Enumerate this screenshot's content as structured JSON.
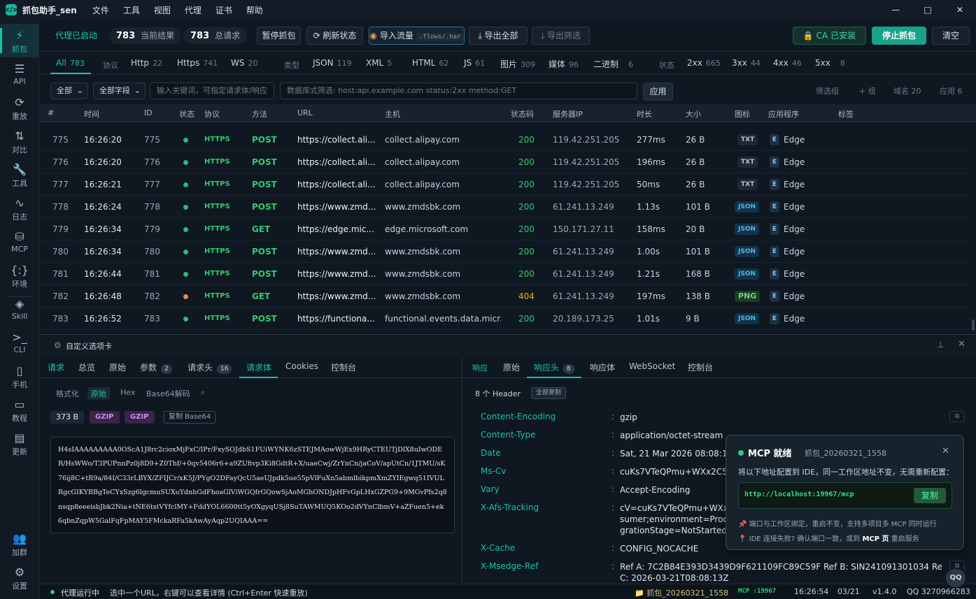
{
  "app": {
    "logo": "</>",
    "title": "抓包助手_sen",
    "menu": [
      "文件",
      "工具",
      "视图",
      "代理",
      "证书",
      "帮助"
    ],
    "window_buttons": [
      "—",
      "□",
      "✕"
    ]
  },
  "sidebar": [
    {
      "icon": "⚡",
      "label": "抓包",
      "active": true
    },
    {
      "icon": "☰",
      "label": "API"
    },
    {
      "icon": "⟳",
      "label": "重放"
    },
    {
      "icon": "⇅",
      "label": "对比"
    },
    {
      "icon": "🔧",
      "label": "工具"
    },
    {
      "icon": "∿",
      "label": "日志"
    },
    {
      "icon": "⛁",
      "label": "MCP"
    },
    {
      "icon": "{:}",
      "label": "环境"
    },
    {
      "icon": "◈",
      "label": "Skill"
    },
    {
      "icon": ">_",
      "label": "CLI"
    },
    {
      "icon": "▯",
      "label": "手机"
    },
    {
      "icon": "▭",
      "label": "教程"
    },
    {
      "icon": "▤",
      "label": "更新"
    },
    {
      "icon": "👥",
      "label": "加群"
    },
    {
      "icon": "⚙",
      "label": "设置"
    }
  ],
  "toolbar": {
    "proxy_status": "代理已启动",
    "current_count": "783",
    "current_label": "当前结果",
    "total_count": "783",
    "total_label": "总请求",
    "pause": "暂停抓包",
    "refresh": "⟳ 刷新状态",
    "import": "导入流量",
    "import_hint": ".flows/.har",
    "export_all": "⤓ 导出全部",
    "export_filtered": "⤓ 导出筛选",
    "ca": "🔒 CA 已安装",
    "stop": "停止抓包",
    "clear": "清空"
  },
  "filters": {
    "all": {
      "label": "All",
      "count": "783"
    },
    "protocol_label": "协议",
    "protocols": [
      {
        "label": "Http",
        "count": "22"
      },
      {
        "label": "Https",
        "count": "741"
      },
      {
        "label": "WS",
        "count": "20"
      }
    ],
    "type_label": "类型",
    "types": [
      {
        "label": "JSON",
        "count": "119"
      },
      {
        "label": "XML",
        "count": "5"
      },
      {
        "label": "HTML",
        "count": "62"
      },
      {
        "label": "JS",
        "count": "61"
      },
      {
        "label": "图片",
        "count": "309"
      },
      {
        "label": "媒体",
        "count": "96"
      },
      {
        "label": "二进制",
        "count": "6"
      }
    ],
    "status_label": "状态",
    "statuses": [
      {
        "label": "2xx",
        "count": "665"
      },
      {
        "label": "3xx",
        "count": "44"
      },
      {
        "label": "4xx",
        "count": "46"
      },
      {
        "label": "5xx",
        "count": "8"
      }
    ]
  },
  "search": {
    "scope": "全部",
    "field": "全部字段",
    "keyword_placeholder": "输入关键词，可指定请求体/响应",
    "db_placeholder": "数据库式筛选: host:api.example.com status:2xx method:GET",
    "apply": "应用",
    "filter_group": "筛选组",
    "add_group": "+ 组",
    "domains": "域名 20",
    "apps": "应用 6"
  },
  "table": {
    "headers": [
      "#",
      "时间",
      "ID",
      "状态",
      "协议",
      "方法",
      "URL",
      "主机",
      "状态码",
      "服务器IP",
      "时长",
      "大小",
      "图标",
      "应用程序",
      "标签"
    ],
    "rows": [
      {
        "n": "775",
        "time": "16:26:20",
        "id": "775",
        "ok": true,
        "proto": "HTTPS",
        "method": "POST",
        "url": "https://collect.ali...",
        "host": "collect.alipay.com",
        "code": "200",
        "ip": "119.42.251.205",
        "dur": "277ms",
        "size": "26 B",
        "icon": "TXT",
        "app": "Edge"
      },
      {
        "n": "776",
        "time": "16:26:20",
        "id": "776",
        "ok": true,
        "proto": "HTTPS",
        "method": "POST",
        "url": "https://collect.ali...",
        "host": "collect.alipay.com",
        "code": "200",
        "ip": "119.42.251.205",
        "dur": "196ms",
        "size": "26 B",
        "icon": "TXT",
        "app": "Edge"
      },
      {
        "n": "777",
        "time": "16:26:21",
        "id": "777",
        "ok": true,
        "proto": "HTTPS",
        "method": "POST",
        "url": "https://collect.ali...",
        "host": "collect.alipay.com",
        "code": "200",
        "ip": "119.42.251.205",
        "dur": "50ms",
        "size": "26 B",
        "icon": "TXT",
        "app": "Edge"
      },
      {
        "n": "778",
        "time": "16:26:24",
        "id": "778",
        "ok": true,
        "proto": "HTTPS",
        "method": "POST",
        "url": "https://www.zmd...",
        "host": "www.zmdsbk.com",
        "code": "200",
        "ip": "61.241.13.249",
        "dur": "1.13s",
        "size": "101 B",
        "icon": "JSON",
        "app": "Edge"
      },
      {
        "n": "779",
        "time": "16:26:34",
        "id": "779",
        "ok": true,
        "proto": "HTTPS",
        "method": "GET",
        "url": "https://edge.mic...",
        "host": "edge.microsoft.com",
        "code": "200",
        "ip": "150.171.27.11",
        "dur": "158ms",
        "size": "20 B",
        "icon": "JSON",
        "app": "Edge"
      },
      {
        "n": "780",
        "time": "16:26:34",
        "id": "780",
        "ok": true,
        "proto": "HTTPS",
        "method": "POST",
        "url": "https://www.zmd...",
        "host": "www.zmdsbk.com",
        "code": "200",
        "ip": "61.241.13.249",
        "dur": "1.00s",
        "size": "101 B",
        "icon": "JSON",
        "app": "Edge"
      },
      {
        "n": "781",
        "time": "16:26:44",
        "id": "781",
        "ok": true,
        "proto": "HTTPS",
        "method": "POST",
        "url": "https://www.zmd...",
        "host": "www.zmdsbk.com",
        "code": "200",
        "ip": "61.241.13.249",
        "dur": "1.21s",
        "size": "168 B",
        "icon": "JSON",
        "app": "Edge"
      },
      {
        "n": "782",
        "time": "16:26:48",
        "id": "782",
        "ok": false,
        "proto": "HTTPS",
        "method": "GET",
        "url": "https://www.zmd...",
        "host": "www.zmdsbk.com",
        "code": "404",
        "ip": "61.241.13.249",
        "dur": "197ms",
        "size": "138 B",
        "icon": "PNG",
        "app": "Edge"
      },
      {
        "n": "783",
        "time": "16:26:52",
        "id": "783",
        "ok": true,
        "proto": "HTTPS",
        "method": "POST",
        "url": "https://functiona...",
        "host": "functional.events.data.micr...",
        "code": "200",
        "ip": "20.189.173.25",
        "dur": "1.01s",
        "size": "9 B",
        "icon": "JSON",
        "app": "Edge"
      }
    ]
  },
  "detail": {
    "title": "自定义选项卡",
    "left_tabs": [
      {
        "label": "请求"
      },
      {
        "label": "总览"
      },
      {
        "label": "原始"
      },
      {
        "label": "参数",
        "count": "2"
      },
      {
        "label": "请求头",
        "count": "16"
      },
      {
        "label": "请求体"
      },
      {
        "label": "Cookies"
      },
      {
        "label": "控制台"
      }
    ],
    "body_modes": [
      "格式化",
      "原始",
      "Hex",
      "Base64解码"
    ],
    "body_size": "373 B",
    "enc1": "GZIP",
    "enc2": "GZIP",
    "copy_b64": "复制 Base64",
    "body_b64": "H4sIAAAAAAAAA0OScA1J8rc2cioxMjFxC/IPr/FxySOJdbS1FUiWYNK6zSTEJMAowWjEx9HRyCTEUTjDlX8uIwODER/HsWWo/T3PUPnnPz0j8D9+Z0Thf/+0qv5406r6+a9ZUfivp3Ki8GdtR+X/uaeCwj/ZrYnCn/jaCoV/apUtCn/1JTMU/sK76ij8C+tR9a/84I/C33rLBYX/ZFIJCr/xK5J/PYgO2DFayQcU5aeUJpdk5ue55pVlFuXn5abmlbikpmXmZYIEgwq51IVULRgcGIKYBBgTeCYxSzg6lgcmuSUXuYdnhGdFhoaGlViWGQfrGQowSjAoMGhONDJpHFvGpLHxGZPG9+9MGvPfs2q8nsqp8eeeisbJbk2Nia+tNE6tstVYfclMY+FddYOL6600tt5yOXgyqUSj8SuTAWMUQ5KOo2dVYnClbmV+aZFuen5+ek6qbnZqpW5GalFqFpMAY5FMckaRFa5kAwAyAqp2UQIAAA==",
    "right_tabs": [
      {
        "label": "响应"
      },
      {
        "label": "原始"
      },
      {
        "label": "响应头",
        "count": "8"
      },
      {
        "label": "响应体"
      },
      {
        "label": "WebSocket"
      },
      {
        "label": "控制台"
      }
    ],
    "header_count": "8 个 Header",
    "copy_all": "全部复制",
    "headers": [
      {
        "k": "Content-Encoding",
        "v": "gzip"
      },
      {
        "k": "Content-Type",
        "v": "application/octet-stream"
      },
      {
        "k": "Date",
        "v": "Sat, 21 Mar 2026 08:08:13 GMT"
      },
      {
        "k": "Ms-Cv",
        "v": "cuKs7VTeQPmu+WXx2C54Ew.0"
      },
      {
        "k": "Vary",
        "v": "Accept-Encoding"
      },
      {
        "k": "X-Afs-Tracking",
        "v": "cV=cuKs7VTeQPmu+WXx2C54Ew.0;clientId=...;consumer;environment=Prod_...;migrationStage=NotStarted",
        "v1": "cV=cuKs7VTeQPmu+WXx2C54Ew.0;clientId=...;con",
        "v2": "sumer;environment=Prod_...;mi",
        "v3": "grationStage=NotStarted"
      },
      {
        "k": "X-Cache",
        "v": "CONFIG_NOCACHE"
      },
      {
        "k": "X-Msedge-Ref",
        "v": "Ref A: 7C2B84E393D3439D9F621109FC89C59F Ref B: SIN241091301034 Ref C: 2026-03-21T08:08:13Z",
        "v1": "Ref A: 7C2B84E393D3439D9F621109FC89C59F Ref B: SIN241091301034 Ref",
        "v2": "C: 2026-03-21T08:08:13Z"
      }
    ]
  },
  "mcp": {
    "title": "MCP 就绪",
    "session": "抓包_20260321_1558",
    "desc": "将以下地址配置到 IDE，同一工作区地址不变，无需重新配置：",
    "url": "http://localhost:19967/mcp",
    "copy": "复制",
    "note1": "📌 端口与工作区绑定，重启不变，支持多项目多 MCP 同时运行",
    "note2_a": "📍 IDE 连接失败? 确认端口一致，或到",
    "note2_b": "MCP 页",
    "note2_c": "重启服务"
  },
  "status": {
    "proxy": "代理运行中",
    "hint": "选中一个URL，右键可以查看详情 (Ctrl+Enter 快速重放)",
    "workspace": "📁 抓包_20260321_1558",
    "mcp": "MCP :19967",
    "time": "16:26:54",
    "date": "03/21",
    "version": "v1.4.0",
    "qq": "QQ 3270966283",
    "qq_badge": "QQ"
  },
  "colors": {
    "accent": "#19c4a5",
    "https": "#2ecc71",
    "post": "#2ecc71",
    "get": "#2ecc71",
    "ok": "#22c07b",
    "warn": "#f08a3c",
    "err": "#f5a623"
  }
}
